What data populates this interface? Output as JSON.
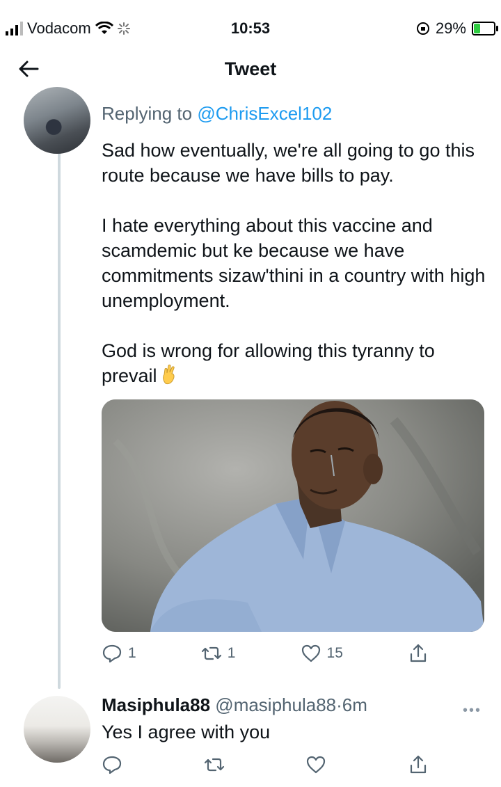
{
  "status_bar": {
    "carrier": "Vodacom",
    "time": "10:53",
    "battery_percent": "29%",
    "battery_level": 0.29,
    "icons": [
      "signal-icon",
      "wifi-icon",
      "activity-icon",
      "orientation-lock-icon",
      "battery-charging-icon"
    ]
  },
  "nav": {
    "title": "Tweet",
    "back_icon": "back-arrow-icon"
  },
  "tweet": {
    "replying_prefix": "Replying to",
    "replying_handle": "@ChrisExcel102",
    "paragraphs": [
      "Sad how eventually, we're all going to go this route because we have bills to pay.",
      "I hate everything about this vaccine and scamdemic but ke because we have commitments sizaw'thini in a country with high unemployment.",
      "God is wrong for allowing this tyranny to prevail"
    ],
    "emoji": "crossed-fingers-emoji",
    "image": "photo of a man in a blue shirt crying",
    "actions": {
      "replies": "1",
      "retweets": "1",
      "likes": "15"
    }
  },
  "reply": {
    "name": "Masiphula88",
    "handle": "@masiphula88",
    "separator": "·",
    "time": "6m",
    "text": "Yes I agree with you",
    "more_icon": "more-options-icon",
    "actions": {
      "replies": "",
      "retweets": "",
      "likes": ""
    }
  },
  "colors": {
    "link": "#1d9bf0",
    "secondary_text": "#536471",
    "thread_line": "#cfd9de",
    "battery_fill": "#2ecc40"
  }
}
